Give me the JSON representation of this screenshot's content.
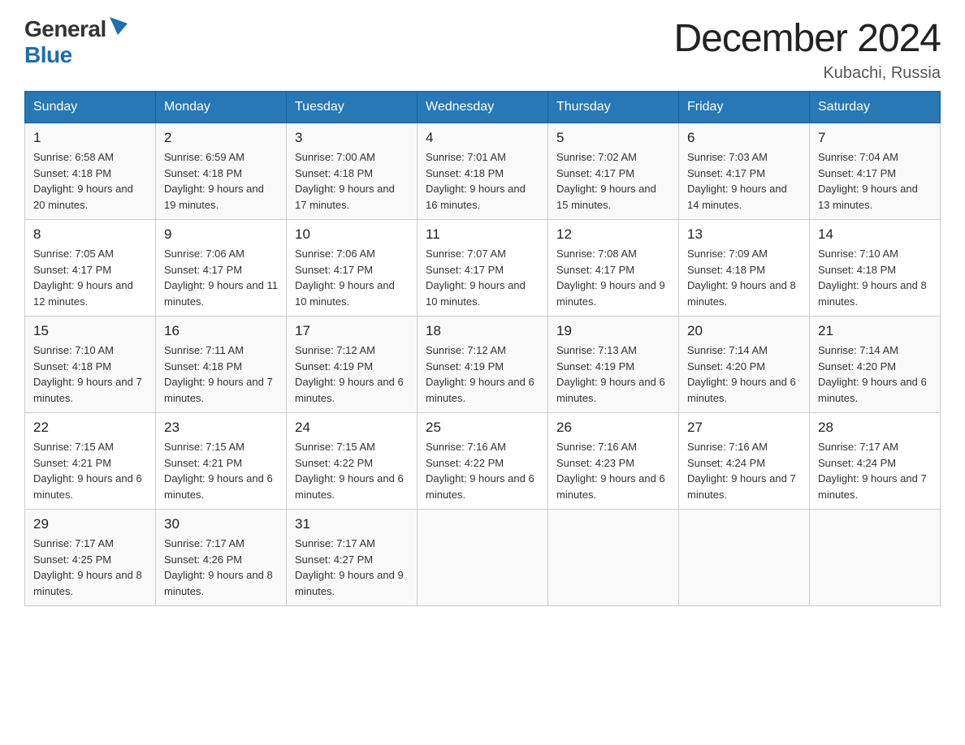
{
  "header": {
    "logo": {
      "general": "General",
      "blue": "Blue",
      "tagline": ""
    },
    "title": "December 2024",
    "location": "Kubachi, Russia"
  },
  "weekdays": [
    "Sunday",
    "Monday",
    "Tuesday",
    "Wednesday",
    "Thursday",
    "Friday",
    "Saturday"
  ],
  "weeks": [
    [
      {
        "day": "1",
        "sunrise": "Sunrise: 6:58 AM",
        "sunset": "Sunset: 4:18 PM",
        "daylight": "Daylight: 9 hours and 20 minutes."
      },
      {
        "day": "2",
        "sunrise": "Sunrise: 6:59 AM",
        "sunset": "Sunset: 4:18 PM",
        "daylight": "Daylight: 9 hours and 19 minutes."
      },
      {
        "day": "3",
        "sunrise": "Sunrise: 7:00 AM",
        "sunset": "Sunset: 4:18 PM",
        "daylight": "Daylight: 9 hours and 17 minutes."
      },
      {
        "day": "4",
        "sunrise": "Sunrise: 7:01 AM",
        "sunset": "Sunset: 4:18 PM",
        "daylight": "Daylight: 9 hours and 16 minutes."
      },
      {
        "day": "5",
        "sunrise": "Sunrise: 7:02 AM",
        "sunset": "Sunset: 4:17 PM",
        "daylight": "Daylight: 9 hours and 15 minutes."
      },
      {
        "day": "6",
        "sunrise": "Sunrise: 7:03 AM",
        "sunset": "Sunset: 4:17 PM",
        "daylight": "Daylight: 9 hours and 14 minutes."
      },
      {
        "day": "7",
        "sunrise": "Sunrise: 7:04 AM",
        "sunset": "Sunset: 4:17 PM",
        "daylight": "Daylight: 9 hours and 13 minutes."
      }
    ],
    [
      {
        "day": "8",
        "sunrise": "Sunrise: 7:05 AM",
        "sunset": "Sunset: 4:17 PM",
        "daylight": "Daylight: 9 hours and 12 minutes."
      },
      {
        "day": "9",
        "sunrise": "Sunrise: 7:06 AM",
        "sunset": "Sunset: 4:17 PM",
        "daylight": "Daylight: 9 hours and 11 minutes."
      },
      {
        "day": "10",
        "sunrise": "Sunrise: 7:06 AM",
        "sunset": "Sunset: 4:17 PM",
        "daylight": "Daylight: 9 hours and 10 minutes."
      },
      {
        "day": "11",
        "sunrise": "Sunrise: 7:07 AM",
        "sunset": "Sunset: 4:17 PM",
        "daylight": "Daylight: 9 hours and 10 minutes."
      },
      {
        "day": "12",
        "sunrise": "Sunrise: 7:08 AM",
        "sunset": "Sunset: 4:17 PM",
        "daylight": "Daylight: 9 hours and 9 minutes."
      },
      {
        "day": "13",
        "sunrise": "Sunrise: 7:09 AM",
        "sunset": "Sunset: 4:18 PM",
        "daylight": "Daylight: 9 hours and 8 minutes."
      },
      {
        "day": "14",
        "sunrise": "Sunrise: 7:10 AM",
        "sunset": "Sunset: 4:18 PM",
        "daylight": "Daylight: 9 hours and 8 minutes."
      }
    ],
    [
      {
        "day": "15",
        "sunrise": "Sunrise: 7:10 AM",
        "sunset": "Sunset: 4:18 PM",
        "daylight": "Daylight: 9 hours and 7 minutes."
      },
      {
        "day": "16",
        "sunrise": "Sunrise: 7:11 AM",
        "sunset": "Sunset: 4:18 PM",
        "daylight": "Daylight: 9 hours and 7 minutes."
      },
      {
        "day": "17",
        "sunrise": "Sunrise: 7:12 AM",
        "sunset": "Sunset: 4:19 PM",
        "daylight": "Daylight: 9 hours and 6 minutes."
      },
      {
        "day": "18",
        "sunrise": "Sunrise: 7:12 AM",
        "sunset": "Sunset: 4:19 PM",
        "daylight": "Daylight: 9 hours and 6 minutes."
      },
      {
        "day": "19",
        "sunrise": "Sunrise: 7:13 AM",
        "sunset": "Sunset: 4:19 PM",
        "daylight": "Daylight: 9 hours and 6 minutes."
      },
      {
        "day": "20",
        "sunrise": "Sunrise: 7:14 AM",
        "sunset": "Sunset: 4:20 PM",
        "daylight": "Daylight: 9 hours and 6 minutes."
      },
      {
        "day": "21",
        "sunrise": "Sunrise: 7:14 AM",
        "sunset": "Sunset: 4:20 PM",
        "daylight": "Daylight: 9 hours and 6 minutes."
      }
    ],
    [
      {
        "day": "22",
        "sunrise": "Sunrise: 7:15 AM",
        "sunset": "Sunset: 4:21 PM",
        "daylight": "Daylight: 9 hours and 6 minutes."
      },
      {
        "day": "23",
        "sunrise": "Sunrise: 7:15 AM",
        "sunset": "Sunset: 4:21 PM",
        "daylight": "Daylight: 9 hours and 6 minutes."
      },
      {
        "day": "24",
        "sunrise": "Sunrise: 7:15 AM",
        "sunset": "Sunset: 4:22 PM",
        "daylight": "Daylight: 9 hours and 6 minutes."
      },
      {
        "day": "25",
        "sunrise": "Sunrise: 7:16 AM",
        "sunset": "Sunset: 4:22 PM",
        "daylight": "Daylight: 9 hours and 6 minutes."
      },
      {
        "day": "26",
        "sunrise": "Sunrise: 7:16 AM",
        "sunset": "Sunset: 4:23 PM",
        "daylight": "Daylight: 9 hours and 6 minutes."
      },
      {
        "day": "27",
        "sunrise": "Sunrise: 7:16 AM",
        "sunset": "Sunset: 4:24 PM",
        "daylight": "Daylight: 9 hours and 7 minutes."
      },
      {
        "day": "28",
        "sunrise": "Sunrise: 7:17 AM",
        "sunset": "Sunset: 4:24 PM",
        "daylight": "Daylight: 9 hours and 7 minutes."
      }
    ],
    [
      {
        "day": "29",
        "sunrise": "Sunrise: 7:17 AM",
        "sunset": "Sunset: 4:25 PM",
        "daylight": "Daylight: 9 hours and 8 minutes."
      },
      {
        "day": "30",
        "sunrise": "Sunrise: 7:17 AM",
        "sunset": "Sunset: 4:26 PM",
        "daylight": "Daylight: 9 hours and 8 minutes."
      },
      {
        "day": "31",
        "sunrise": "Sunrise: 7:17 AM",
        "sunset": "Sunset: 4:27 PM",
        "daylight": "Daylight: 9 hours and 9 minutes."
      },
      null,
      null,
      null,
      null
    ]
  ]
}
